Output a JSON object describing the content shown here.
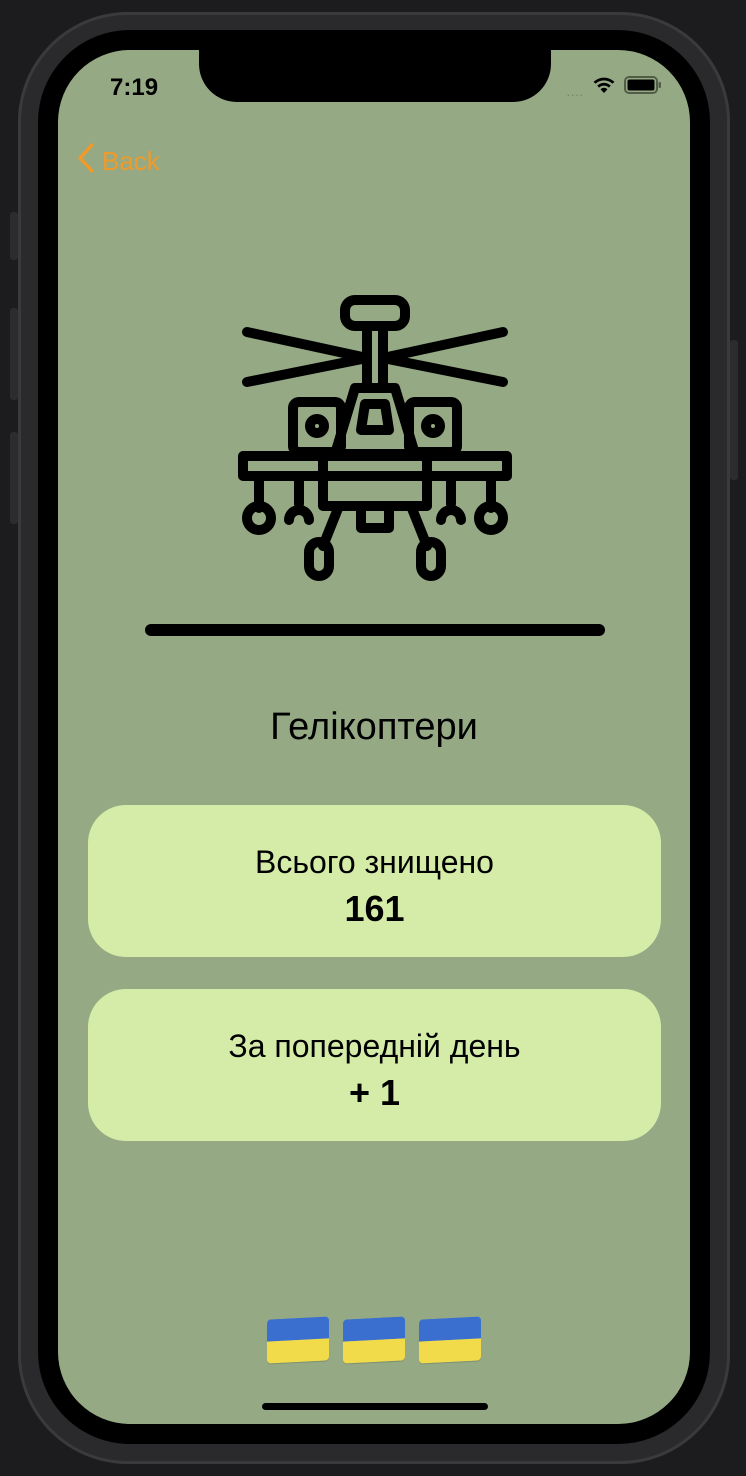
{
  "status_bar": {
    "time": "7:19",
    "signal": "....",
    "wifi_icon": "wifi-icon",
    "battery_icon": "battery-icon"
  },
  "nav": {
    "back_label": "Back",
    "back_icon": "chevron-left-icon"
  },
  "hero": {
    "icon": "helicopter-icon"
  },
  "category": {
    "title": "Гелікоптери"
  },
  "stats": [
    {
      "label": "Всього знищено",
      "value": "161"
    },
    {
      "label": "За попередній день",
      "value": "+ 1"
    }
  ],
  "flags": [
    {
      "icon": "ukraine-flag-icon"
    },
    {
      "icon": "ukraine-flag-icon"
    },
    {
      "icon": "ukraine-flag-icon"
    }
  ],
  "colors": {
    "screen_bg": "#95aa84",
    "card_bg": "#d4eca8",
    "accent": "#f09a2a",
    "flag_blue": "#3a6fd0",
    "flag_yellow": "#f2db4a"
  }
}
